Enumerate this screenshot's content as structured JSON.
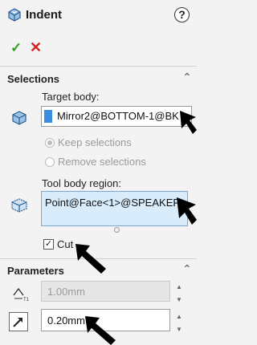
{
  "header": {
    "title": "Indent",
    "help_label": "?"
  },
  "actions": {
    "ok_label": "✓",
    "cancel_label": "✕"
  },
  "selections": {
    "section_title": "Selections",
    "target_body_label": "Target body:",
    "target_body_value": "Mirror2@BOTTOM-1@BK",
    "keep_label": "Keep selections",
    "remove_label": "Remove selections",
    "tool_body_label": "Tool body region:",
    "tool_body_value": "Point@Face<1>@SPEAKER",
    "cut_label": "Cut",
    "cut_checked": true
  },
  "parameters": {
    "section_title": "Parameters",
    "thickness_value": "1.00mm",
    "clearance_value": "0.20mm"
  },
  "icons": [
    "indent-feature-icon",
    "help-icon",
    "ok-icon",
    "cancel-icon",
    "collapse-chevron-icon",
    "body-icon",
    "tool-body-icon",
    "thickness-icon",
    "clearance-icon",
    "arrow-annotation"
  ]
}
